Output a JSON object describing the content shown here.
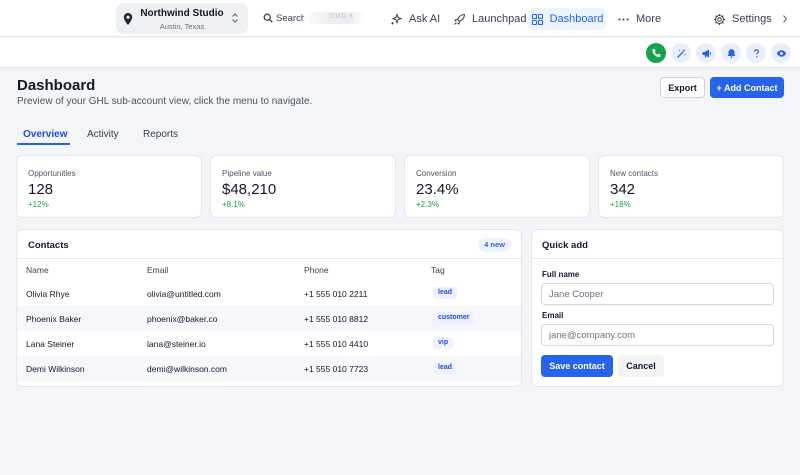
{
  "account": {
    "name": "Northwind Studio",
    "location": "Austin, Texas",
    "icon": "map-pin-icon"
  },
  "search": {
    "label": "Search",
    "shortcut_hint": "CMD K"
  },
  "nav": {
    "ask_ai": "Ask AI",
    "launchpad": "Launchpad",
    "dashboard": "Dashboard",
    "more": "More",
    "settings": "Settings"
  },
  "iconbar": [
    "phone-icon",
    "magic-wand-icon",
    "megaphone-icon",
    "bell-icon",
    "help-icon",
    "eye-icon"
  ],
  "header": {
    "title": "Dashboard",
    "subtitle": "Preview of your GHL sub-account view, click the menu to navigate.",
    "export_label": "Export",
    "add_contact_label": "+ Add Contact"
  },
  "tabs": [
    {
      "label": "Overview",
      "active": true
    },
    {
      "label": "Activity",
      "active": false
    },
    {
      "label": "Reports",
      "active": false
    }
  ],
  "stats": [
    {
      "label": "Opportunities",
      "value": "128",
      "change": "+12%"
    },
    {
      "label": "Pipeline value",
      "value": "$48,210",
      "change": "+8.1%"
    },
    {
      "label": "Conversion",
      "value": "23.4%",
      "change": "+2.3%"
    },
    {
      "label": "New contacts",
      "value": "342",
      "change": "+18%"
    }
  ],
  "contacts": {
    "title": "Contacts",
    "badge": "4 new",
    "columns": [
      "Name",
      "Email",
      "Phone",
      "Tag"
    ],
    "rows": [
      {
        "name": "Olivia Rhye",
        "email": "olivia@untitled.com",
        "phone": "+1 555 010 2211",
        "tag": "lead"
      },
      {
        "name": "Phoenix Baker",
        "email": "phoenix@baker.co",
        "phone": "+1 555 010 8812",
        "tag": "customer"
      },
      {
        "name": "Lana Steiner",
        "email": "lana@steiner.io",
        "phone": "+1 555 010 4410",
        "tag": "vip"
      },
      {
        "name": "Demi Wilkinson",
        "email": "demi@wilkinson.com",
        "phone": "+1 555 010 7723",
        "tag": "lead"
      }
    ]
  },
  "quick_add": {
    "title": "Quick add",
    "full_name_label": "Full name",
    "full_name_placeholder": "Jane Cooper",
    "email_label": "Email",
    "email_placeholder": "jane@company.com",
    "save_label": "Save contact",
    "cancel_label": "Cancel"
  },
  "colors": {
    "accent": "#2563eb",
    "positive": "#16a34a",
    "phone_button": "#16a34a",
    "background": "#f3f5f9"
  }
}
